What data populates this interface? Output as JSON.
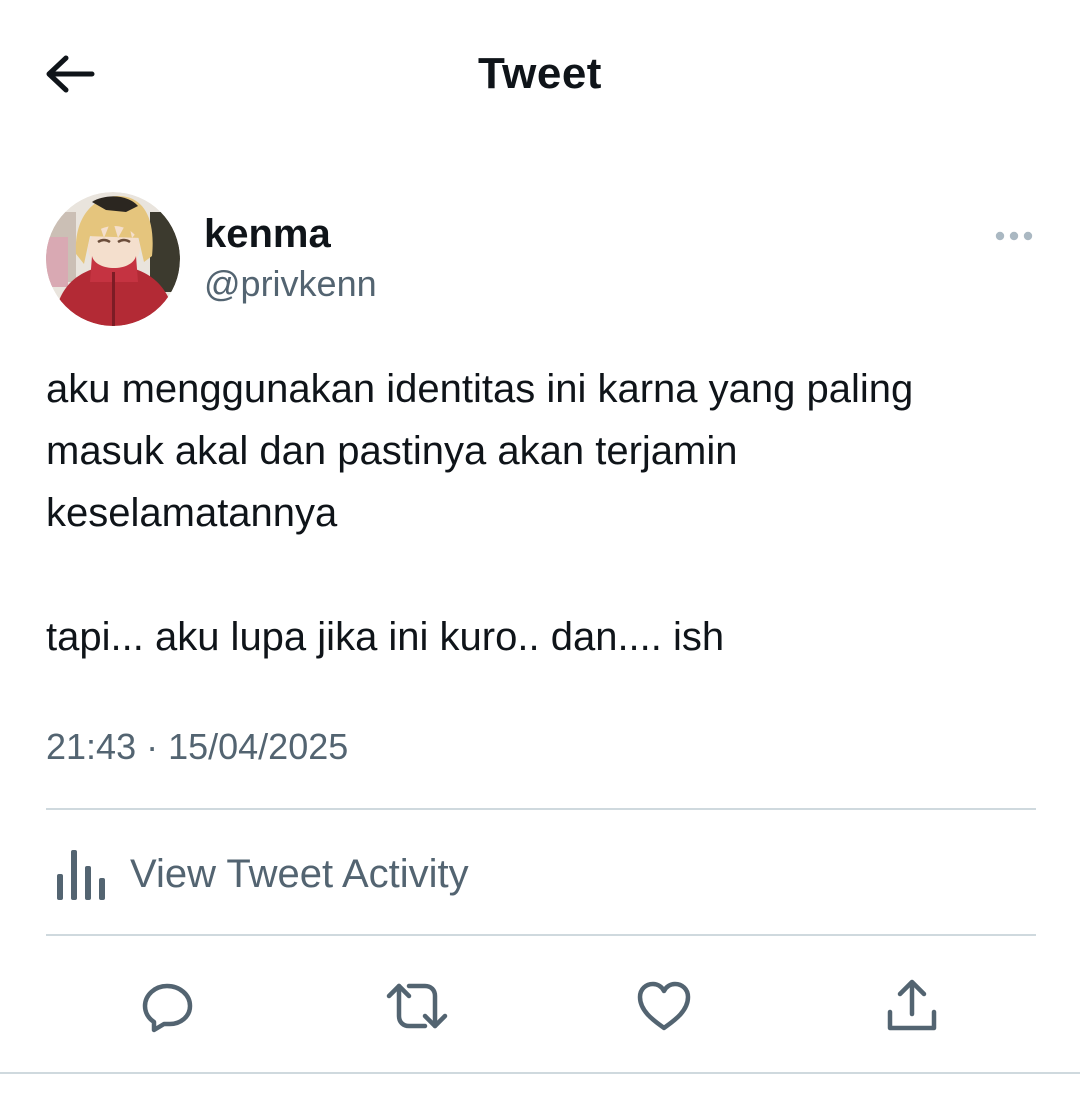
{
  "header": {
    "title": "Tweet",
    "back_icon": "arrow-left-icon"
  },
  "author": {
    "display_name": "kenma",
    "handle": "@privkenn",
    "avatar_icon": "avatar-image",
    "more_icon": "more-horizontal-icon"
  },
  "tweet": {
    "paragraphs": [
      "aku menggunakan identitas ini karna yang paling masuk akal dan pastinya akan terjamin keselamatannya",
      "tapi... aku lupa jika ini kuro.. dan.... ish"
    ],
    "timestamp": "21:43 · 15/04/2025"
  },
  "activity": {
    "label": "View Tweet Activity",
    "icon": "bar-chart-icon"
  },
  "actions": {
    "reply_icon": "reply-icon",
    "retweet_icon": "retweet-icon",
    "like_icon": "heart-icon",
    "share_icon": "share-icon"
  },
  "colors": {
    "text_primary": "#0f1419",
    "text_secondary": "#536471",
    "divider": "#cfd9de",
    "icon_gray": "#536471"
  }
}
